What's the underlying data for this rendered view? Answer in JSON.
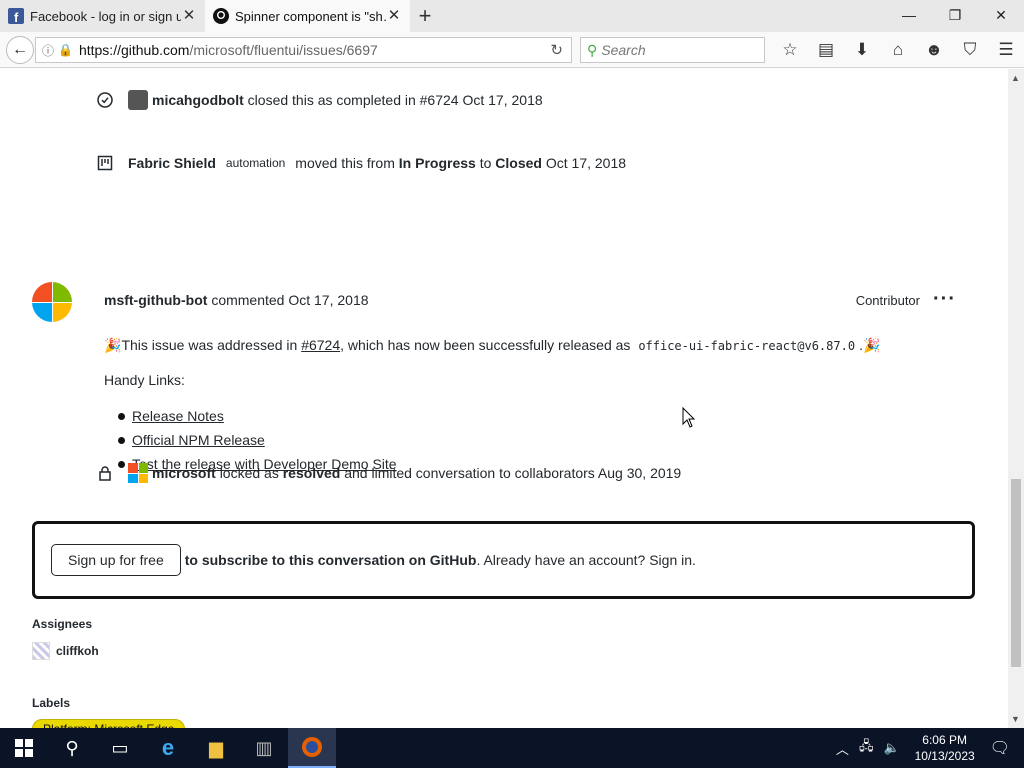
{
  "browser": {
    "tabs": [
      {
        "title": "Facebook - log in or sign up",
        "active": false,
        "icon": "facebook-icon"
      },
      {
        "title": "Spinner component is \"sh…",
        "active": true,
        "icon": "github-icon"
      }
    ],
    "url": {
      "host": "https://github.com",
      "path": "/microsoft/fluentui/issues/6697"
    },
    "search_placeholder": "Search"
  },
  "timeline": {
    "closed_event": {
      "user": "micahgodbolt",
      "text": "closed this as completed in #6724 Oct 17, 2018"
    },
    "moved_event": {
      "user": "Fabric Shield",
      "badge": "automation",
      "text_pre": "moved this from",
      "from": "In Progress",
      "to_word": "to",
      "to": "Closed",
      "date": "Oct 17, 2018"
    },
    "comment": {
      "author": "msft-github-bot",
      "meta": "commented Oct 17, 2018",
      "role": "Contributor",
      "line1_pre": "This issue was addressed in",
      "line1_link": "#6724",
      "line1_mid": ", which has now been successfully released as",
      "line1_code": "office-ui-fabric-react@v6.87.0",
      "line1_post": ".",
      "handy": "Handy Links:",
      "links": [
        "Release Notes",
        "Official NPM Release",
        "Test the release with Developer Demo Site"
      ]
    },
    "locked_event": {
      "user": "microsoft",
      "text_pre": "locked as",
      "state": "resolved",
      "text_post": "and limited conversation to collaborators Aug 30, 2019"
    }
  },
  "signup": {
    "button": "Sign up for free",
    "bold": "to subscribe to this conversation on GitHub",
    "rest": ". Already have an account? Sign in."
  },
  "sidebar": {
    "assignees_heading": "Assignees",
    "assignee": "cliffkoh",
    "labels_heading": "Labels",
    "label": "Platform: Microsoft Edge"
  },
  "taskbar": {
    "time": "6:06 PM",
    "date": "10/13/2023"
  },
  "colors": {
    "tab_bg": "#e8e8e8",
    "taskbar": "#0b1426",
    "ms_red": "#f25022",
    "ms_green": "#7fba00",
    "ms_blue": "#00a4ef",
    "ms_yellow": "#ffb900"
  }
}
